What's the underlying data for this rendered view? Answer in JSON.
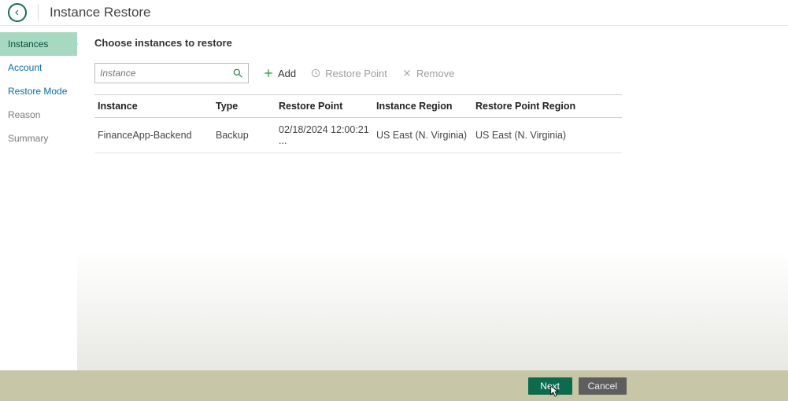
{
  "header": {
    "title": "Instance Restore"
  },
  "sidebar": {
    "items": [
      {
        "label": "Instances"
      },
      {
        "label": "Account"
      },
      {
        "label": "Restore Mode"
      },
      {
        "label": "Reason"
      },
      {
        "label": "Summary"
      }
    ]
  },
  "main": {
    "section_title": "Choose instances to restore",
    "search_placeholder": "Instance",
    "toolbar": {
      "add": "Add",
      "restore_point": "Restore Point",
      "remove": "Remove"
    },
    "table": {
      "headers": {
        "instance": "Instance",
        "type": "Type",
        "restore_point": "Restore Point",
        "instance_region": "Instance Region",
        "restore_point_region": "Restore Point Region"
      },
      "rows": [
        {
          "instance": "FinanceApp-Backend",
          "type": "Backup",
          "restore_point": "02/18/2024 12:00:21 ...",
          "instance_region": "US East (N. Virginia)",
          "restore_point_region": "US East (N. Virginia)"
        }
      ]
    }
  },
  "footer": {
    "next": "Next",
    "cancel": "Cancel"
  }
}
